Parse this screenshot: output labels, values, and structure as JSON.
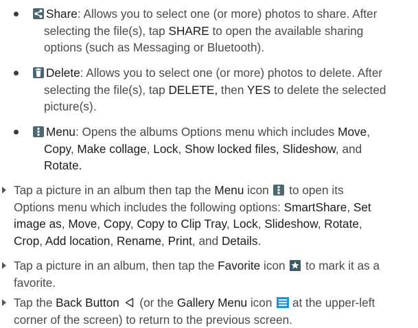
{
  "bullets": [
    {
      "icon": "share-icon",
      "term": "Share",
      "line1_rest": ": Allows you to select one (or more) photos to share. After",
      "line2_pre": "selecting the file(s), tap ",
      "line2_bold": "SHARE",
      "line2_post": " to open the available sharing",
      "line3": "options (such as Messaging or Bluetooth)."
    },
    {
      "icon": "delete-icon",
      "term": "Delete",
      "line1_rest": ": Allows you to select one (or more) photos to delete. After",
      "line2_pre": "selecting the file(s), tap ",
      "line2_bold1": "DELETE,",
      "line2_mid": " then ",
      "line2_bold2": "YES",
      "line2_post": " to delete the selected",
      "line3": "picture(s)."
    },
    {
      "icon": "menu-icon",
      "term": "Menu",
      "line1_rest": ": Opens the albums Options menu which includes ",
      "line1_bold": "Move",
      "line1_end": ",",
      "line2": {
        "b1": "Copy",
        "s1": ", ",
        "b2": "Make collage",
        "s2": ", ",
        "b3": "Lock",
        "s3": ", ",
        "b4": "Show locked files,",
        "s4": " ",
        "b5": "Slideshow",
        "s5": ", and"
      },
      "line3_bold": "Rotate."
    }
  ],
  "arrows": [
    {
      "l1_pre": "Tap a picture in an album then tap the ",
      "l1_bold": "Menu",
      "l1_mid": " icon ",
      "l1_post": " to open its",
      "l2_pre": "Options menu which includes the following options: ",
      "l2_b1": "SmartShare",
      "l2_s1": ", ",
      "l2_b2": "Set",
      "l3_b1": "image as",
      "l3_s1": ", ",
      "l3_b2": "Move",
      "l3_s2": ", ",
      "l3_b3": "Copy",
      "l3_s3": ", ",
      "l3_b4": "Copy to Clip Tray",
      "l3_s4": ", ",
      "l3_b5": "Lock",
      "l3_s5": ", ",
      "l3_b6": "Slideshow",
      "l3_s6": ", ",
      "l3_b7": "Rotate",
      "l3_s7": ",",
      "l4_b1": "Crop",
      "l4_s1": ", ",
      "l4_b2": "Add location",
      "l4_s2": ", ",
      "l4_b3": "Rename",
      "l4_s3": ", ",
      "l4_b4": "Print",
      "l4_s4": ", and ",
      "l4_b5": "Details",
      "l4_s5": "."
    },
    {
      "l1_pre": "Tap a picture in an album, then tap the ",
      "l1_bold": "Favorite",
      "l1_mid": " icon ",
      "l1_post": " to mark it as a",
      "l2": "favorite."
    },
    {
      "l1_pre": "Tap the ",
      "l1_bold": "Back Button",
      "l1_mid": " (or the ",
      "l1_bold2": "Gallery Menu",
      "l1_mid2": " icon ",
      "l1_post": " at the upper-left",
      "l2": "corner of the screen) to return to the previous screen."
    }
  ],
  "colors": {
    "icon_bg": "#4f6771",
    "favorite_bg": "#3f5a64",
    "gallery_menu_blue": "#1a96d6",
    "text": "#4a4a4a",
    "bold_text": "#1c1c1c"
  }
}
